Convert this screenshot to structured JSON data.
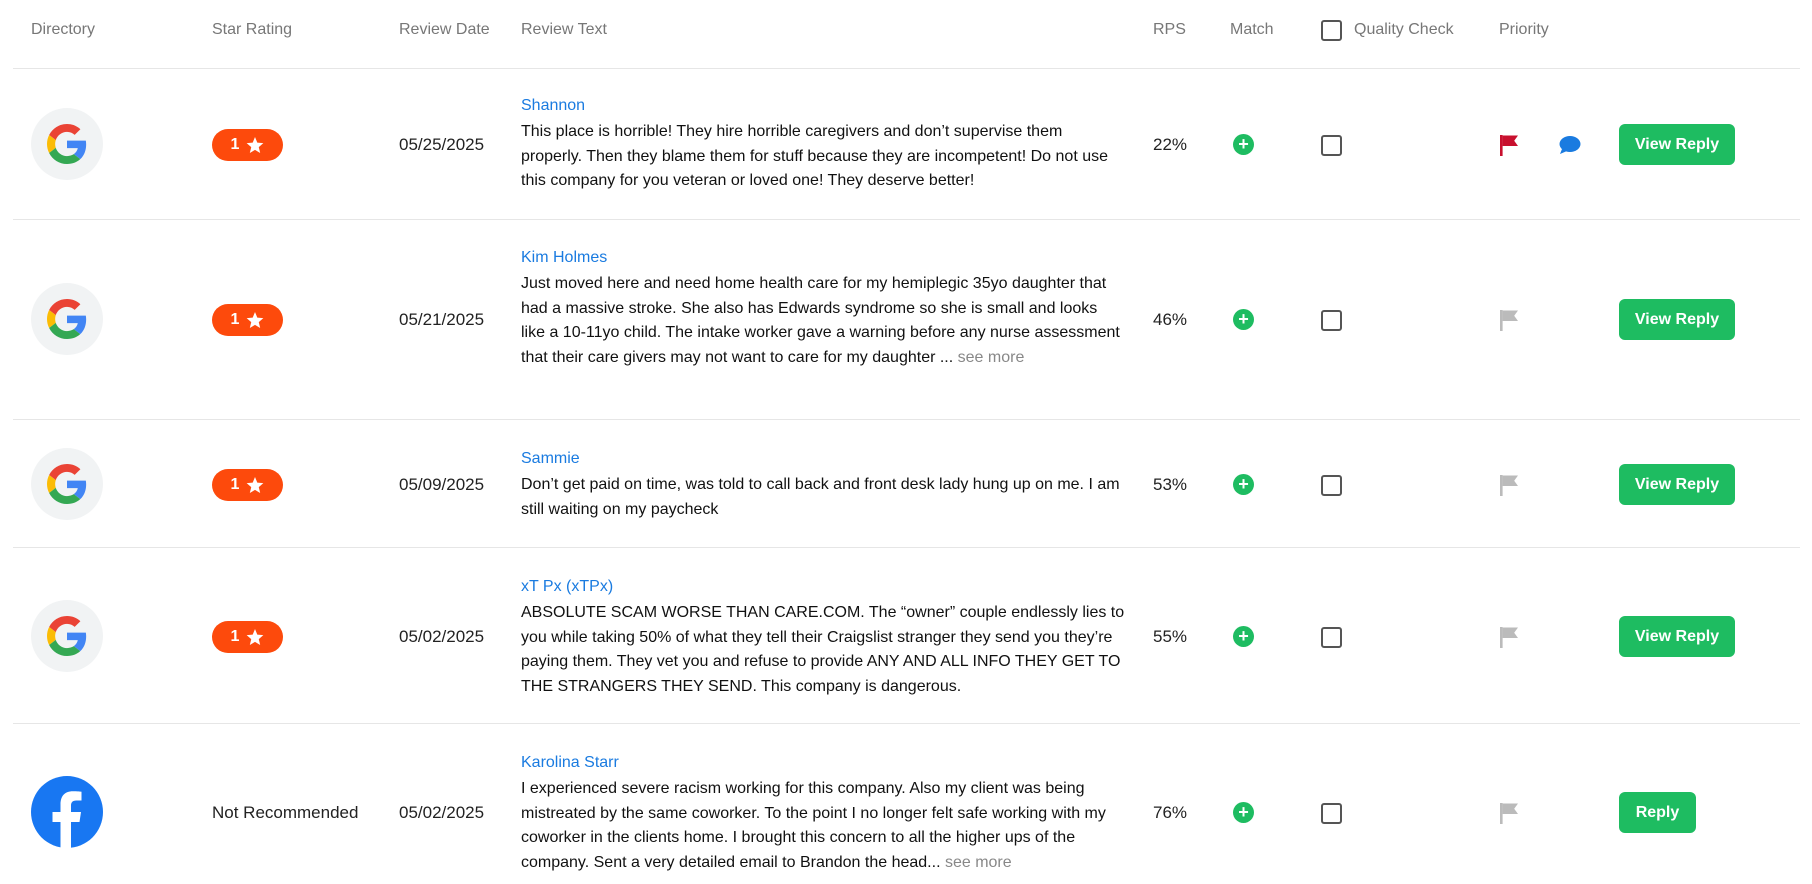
{
  "columns": {
    "directory": "Directory",
    "star_rating": "Star Rating",
    "review_date": "Review Date",
    "review_text": "Review Text",
    "rps": "RPS",
    "match": "Match",
    "quality_check": "Quality Check",
    "priority": "Priority"
  },
  "colors": {
    "rating_pill": "#fd4a0c",
    "accent_green": "#1ebc61",
    "link_blue": "#1a7be0",
    "flag_red": "#c8102e",
    "flag_gray": "#bbbbbb"
  },
  "rows": [
    {
      "directory": "google-icon",
      "rating": "1",
      "rating_icon": "star-icon",
      "date": "05/25/2025",
      "author": "Shannon",
      "text": "This place is horrible! They hire horrible caregivers and don’t supervise them properly. Then they blame them for stuff because they are incompetent! Do not use this company for you veteran or loved one! They deserve better!",
      "see_more": "",
      "rps": "22%",
      "match_icon": "plus-icon",
      "quality_checked": false,
      "priority_flagged": true,
      "has_comment": true,
      "action": "View Reply"
    },
    {
      "directory": "google-icon",
      "rating": "1",
      "rating_icon": "star-icon",
      "date": "05/21/2025",
      "author": "Kim Holmes",
      "text": "Just moved here and need home health care for my hemiplegic 35yo daughter that had a massive stroke. She also has Edwards syndrome so she is small and looks like a 10-11yo child. The intake worker gave a warning before any nurse assessment that their care givers may not want to care for my daughter ...",
      "see_more": " see more",
      "rps": "46%",
      "match_icon": "plus-icon",
      "quality_checked": false,
      "priority_flagged": false,
      "has_comment": false,
      "action": "View Reply"
    },
    {
      "directory": "google-icon",
      "rating": "1",
      "rating_icon": "star-icon",
      "date": "05/09/2025",
      "author": "Sammie",
      "text": "Don’t get paid on time, was told to call back and front desk lady hung up on me. I am still waiting on my paycheck",
      "see_more": "",
      "rps": "53%",
      "match_icon": "plus-icon",
      "quality_checked": false,
      "priority_flagged": false,
      "has_comment": false,
      "action": "View Reply"
    },
    {
      "directory": "google-icon",
      "rating": "1",
      "rating_icon": "star-icon",
      "date": "05/02/2025",
      "author": "xT Px (xTPx)",
      "text": "ABSOLUTE SCAM WORSE THAN CARE.COM. The “owner” couple endlessly lies to you while taking 50% of what they tell their Craigslist stranger they send you they’re paying them. They vet you and refuse to provide ANY AND ALL INFO THEY GET TO THE STRANGERS THEY SEND. This company is dangerous.",
      "see_more": "",
      "rps": "55%",
      "match_icon": "plus-icon",
      "quality_checked": false,
      "priority_flagged": false,
      "has_comment": false,
      "action": "View Reply"
    },
    {
      "directory": "facebook-icon",
      "rating": "Not Recommended",
      "rating_icon": "",
      "date": "05/02/2025",
      "author": "Karolina Starr",
      "text": "I experienced severe racism working for this company. Also my client was being mistreated by the same coworker. To the point I no longer felt safe working with my coworker in the clients home. I brought this concern to all the higher ups of the company. Sent a very detailed email to Brandon the head...",
      "see_more": " see more",
      "rps": "76%",
      "match_icon": "plus-icon",
      "quality_checked": false,
      "priority_flagged": false,
      "has_comment": false,
      "action": "Reply"
    }
  ]
}
